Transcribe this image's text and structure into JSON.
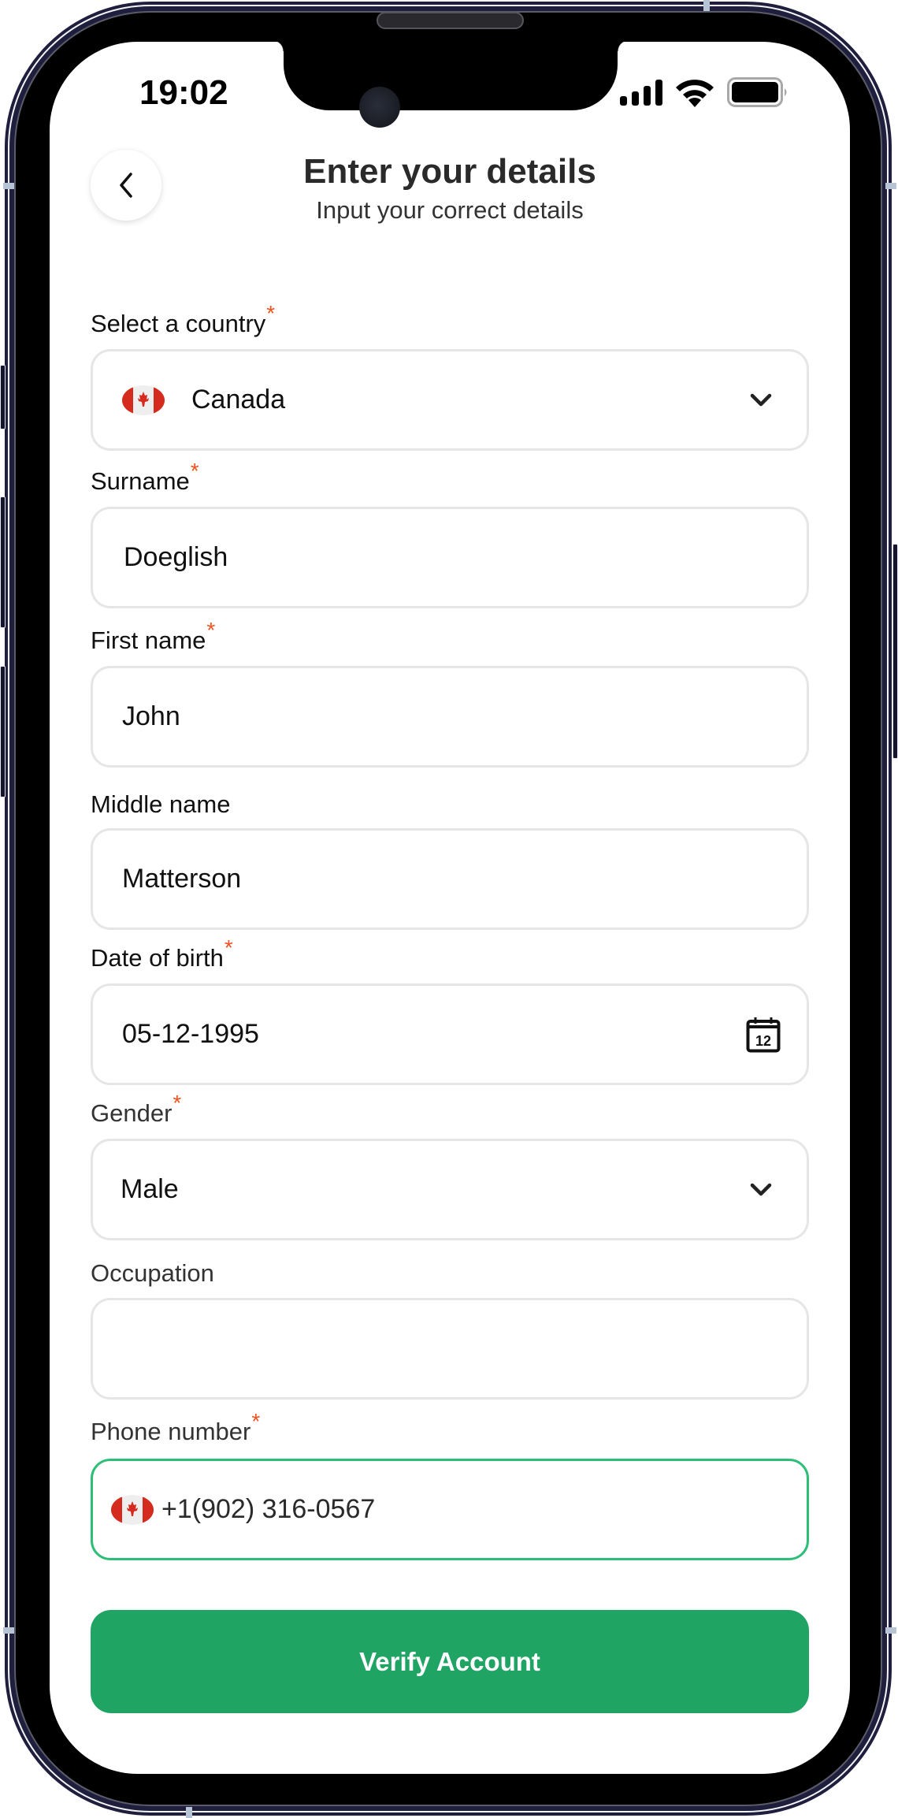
{
  "status_bar": {
    "time": "19:02",
    "icons": [
      "cellular-signal-icon",
      "wifi-icon",
      "battery-icon"
    ]
  },
  "header": {
    "back_icon": "chevron-left-icon",
    "title": "Enter your details",
    "subtitle": "Input your correct details"
  },
  "colors": {
    "accent": "#20A463",
    "active_border": "#2DBE78",
    "required_asterisk": "#F4511E",
    "field_border": "#E6E6E6"
  },
  "form": {
    "required_mark": "*",
    "country": {
      "label": "Select a country",
      "required": true,
      "value": "Canada",
      "flag": "canada-flag-icon",
      "icon": "chevron-down-icon"
    },
    "surname": {
      "label": "Surname",
      "required": true,
      "value": "Doeglish"
    },
    "first_name": {
      "label": "First name",
      "required": true,
      "value": "John"
    },
    "middle_name": {
      "label": "Middle name",
      "required": false,
      "value": "Matterson"
    },
    "date_of_birth": {
      "label": "Date of birth",
      "required": true,
      "value": "05-12-1995",
      "icon": "calendar-icon",
      "icon_text": "12"
    },
    "gender": {
      "label": "Gender",
      "required": true,
      "value": "Male",
      "icon": "chevron-down-icon"
    },
    "occupation": {
      "label": "Occupation",
      "required": false,
      "value": ""
    },
    "phone": {
      "label": "Phone number",
      "required": true,
      "value": "+1(902) 316-0567",
      "flag": "canada-flag-icon",
      "focused": true
    }
  },
  "actions": {
    "verify_label": "Verify Account"
  }
}
